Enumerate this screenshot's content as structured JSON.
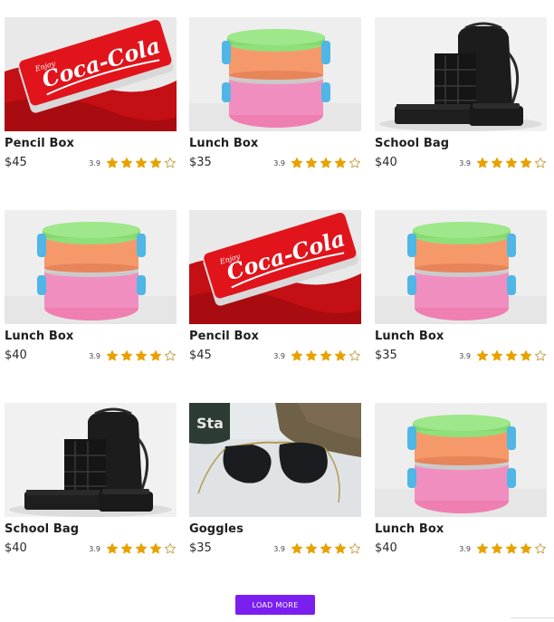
{
  "products": [
    {
      "name": "Pencil Box",
      "price": "$45",
      "rating": "3.9",
      "stars": 4,
      "image": "pencil-box-image"
    },
    {
      "name": "Lunch Box",
      "price": "$35",
      "rating": "3.9",
      "stars": 4,
      "image": "lunch-box-image"
    },
    {
      "name": "School Bag",
      "price": "$40",
      "rating": "3.9",
      "stars": 4,
      "image": "school-bag-image"
    },
    {
      "name": "Lunch Box",
      "price": "$40",
      "rating": "3.9",
      "stars": 4,
      "image": "lunch-box-image"
    },
    {
      "name": "Pencil Box",
      "price": "$45",
      "rating": "3.9",
      "stars": 4,
      "image": "pencil-box-image"
    },
    {
      "name": "Lunch Box",
      "price": "$35",
      "rating": "3.9",
      "stars": 4,
      "image": "lunch-box-image"
    },
    {
      "name": "School Bag",
      "price": "$40",
      "rating": "3.9",
      "stars": 4,
      "image": "school-bag-image"
    },
    {
      "name": "Goggles",
      "price": "$35",
      "rating": "3.9",
      "stars": 4,
      "image": "goggles-image"
    },
    {
      "name": "Lunch Box",
      "price": "$40",
      "rating": "3.9",
      "stars": 4,
      "image": "lunch-box-image"
    }
  ],
  "image_text": {
    "tin_brand": "Coca-Cola",
    "tin_tagline": "Enjoy",
    "bag_label": "Sta"
  },
  "load_more_label": "LOAD MORE",
  "colors": {
    "accent": "#7a1ff0",
    "star": "#e8a200",
    "star_empty": "#c9a24a"
  }
}
